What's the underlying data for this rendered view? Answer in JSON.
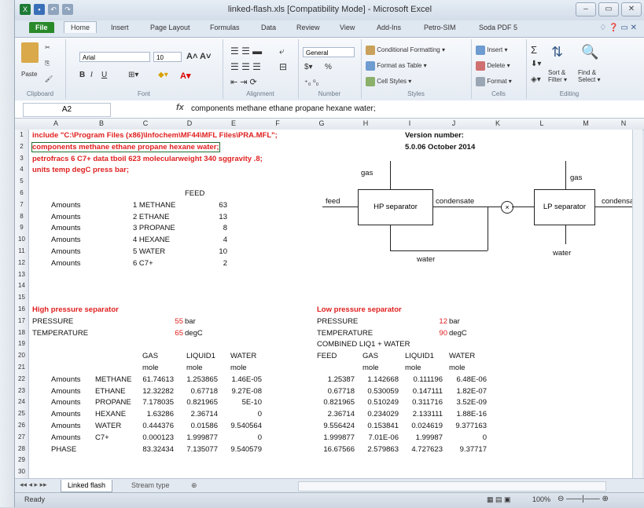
{
  "window": {
    "title": "linked-flash.xls  [Compatibility Mode] - Microsoft Excel",
    "controls": [
      "–",
      "▭",
      "✕"
    ]
  },
  "tabs": [
    "File",
    "Home",
    "Insert",
    "Page Layout",
    "Formulas",
    "Data",
    "Review",
    "View",
    "Add-Ins",
    "Petro-SIM",
    "Soda PDF 5"
  ],
  "ribbon": {
    "clipboard": {
      "label": "Clipboard",
      "paste": "Paste"
    },
    "font": {
      "label": "Font",
      "name": "Arial",
      "size": "10",
      "bold": "B",
      "italic": "I",
      "underline": "U"
    },
    "alignment": {
      "label": "Alignment"
    },
    "number": {
      "label": "Number",
      "format": "General",
      "percent": "%"
    },
    "styles": {
      "label": "Styles",
      "cond": "Conditional Formatting ▾",
      "table": "Format as Table ▾",
      "cell": "Cell Styles ▾"
    },
    "cells": {
      "label": "Cells",
      "insert": "Insert ▾",
      "delete": "Delete ▾",
      "format": "Format ▾"
    },
    "editing": {
      "label": "Editing",
      "sort": "Sort & Filter ▾",
      "find": "Find & Select ▾",
      "sigma": "Σ"
    }
  },
  "formula_bar": {
    "name_box": "A2",
    "fx": "fx",
    "content": "components methane ethane propane hexane water;"
  },
  "columns": [
    "A",
    "B",
    "C",
    "D",
    "E",
    "F",
    "G",
    "H",
    "I",
    "J",
    "K",
    "L",
    "M",
    "N"
  ],
  "rows": [
    "1",
    "2",
    "3",
    "4",
    "5",
    "6",
    "7",
    "8",
    "9",
    "10",
    "11",
    "12",
    "13",
    "14",
    "15",
    "16",
    "17",
    "18",
    "19",
    "20",
    "21",
    "22",
    "23",
    "24",
    "25",
    "26",
    "27",
    "28",
    "29",
    "30"
  ],
  "script_lines": [
    "include \"C:\\Program Files (x86)\\Infochem\\MF44\\MFL Files\\PRA.MFL\";",
    "components methane ethane propane hexane water;",
    "petrofracs 6 C7+ data tboil 623 molecularweight 340 sggravity .8;",
    "units temp degC press bar;"
  ],
  "version": {
    "label": "Version number:",
    "value": "5.0.06 October 2014"
  },
  "feed": {
    "header": "FEED",
    "rows": [
      [
        "Amounts",
        "1 METHANE",
        "63"
      ],
      [
        "Amounts",
        "2 ETHANE",
        "13"
      ],
      [
        "Amounts",
        "3 PROPANE",
        "8"
      ],
      [
        "Amounts",
        "4 HEXANE",
        "4"
      ],
      [
        "Amounts",
        "5 WATER",
        "10"
      ],
      [
        "Amounts",
        "6 C7+",
        "2"
      ]
    ]
  },
  "diagram": {
    "feed": "feed",
    "gas1": "gas",
    "hp": "HP separator",
    "condensate1": "condensate",
    "water1": "water",
    "gas2": "gas",
    "lp": "LP separator",
    "condensate2": "condensate",
    "water2": "water"
  },
  "hp_section": {
    "title": "High pressure separator",
    "pressure_label": "PRESSURE",
    "pressure_value": "55",
    "pressure_unit": "bar",
    "temp_label": "TEMPERATURE",
    "temp_value": "65",
    "temp_unit": "degC",
    "headers": [
      "GAS",
      "LIQUID1",
      "WATER"
    ],
    "units": [
      "mole",
      "mole",
      "mole"
    ],
    "rows": [
      [
        "Amounts",
        "METHANE",
        "61.74613",
        "1.253865",
        "1.46E-05"
      ],
      [
        "Amounts",
        "ETHANE",
        "12.32282",
        "0.67718",
        "9.27E-08"
      ],
      [
        "Amounts",
        "PROPANE",
        "7.178035",
        "0.821965",
        "5E-10"
      ],
      [
        "Amounts",
        "HEXANE",
        "1.63286",
        "2.36714",
        "0"
      ],
      [
        "Amounts",
        "WATER",
        "0.444376",
        "0.01586",
        "9.540564"
      ],
      [
        "Amounts",
        "C7+",
        "0.000123",
        "1.999877",
        "0"
      ],
      [
        "PHASE",
        "",
        "83.32434",
        "7.135077",
        "9.540579"
      ]
    ]
  },
  "lp_section": {
    "title": "Low pressure separator",
    "pressure_label": "PRESSURE",
    "pressure_value": "12",
    "pressure_unit": "bar",
    "temp_label": "TEMPERATURE",
    "temp_value": "90",
    "temp_unit": "degC",
    "combined": "COMBINED LIQ1 + WATER",
    "headers": [
      "FEED",
      "GAS",
      "LIQUID1",
      "WATER"
    ],
    "units": [
      "",
      "mole",
      "mole",
      "mole"
    ],
    "rows": [
      [
        "1.25387",
        "1.142668",
        "0.111196",
        "6.48E-06"
      ],
      [
        "0.67718",
        "0.530059",
        "0.147111",
        "1.82E-07"
      ],
      [
        "0.821965",
        "0.510249",
        "0.311716",
        "3.52E-09"
      ],
      [
        "2.36714",
        "0.234029",
        "2.133111",
        "1.88E-16"
      ],
      [
        "9.556424",
        "0.153841",
        "0.024619",
        "9.377163"
      ],
      [
        "1.999877",
        "7.01E-06",
        "1.99987",
        "0"
      ],
      [
        "16.67566",
        "2.579863",
        "4.727623",
        "9.37717"
      ]
    ]
  },
  "sheet_tabs": [
    "Linked flash",
    "Stream type"
  ],
  "status": {
    "ready": "Ready",
    "zoom": "100%"
  }
}
